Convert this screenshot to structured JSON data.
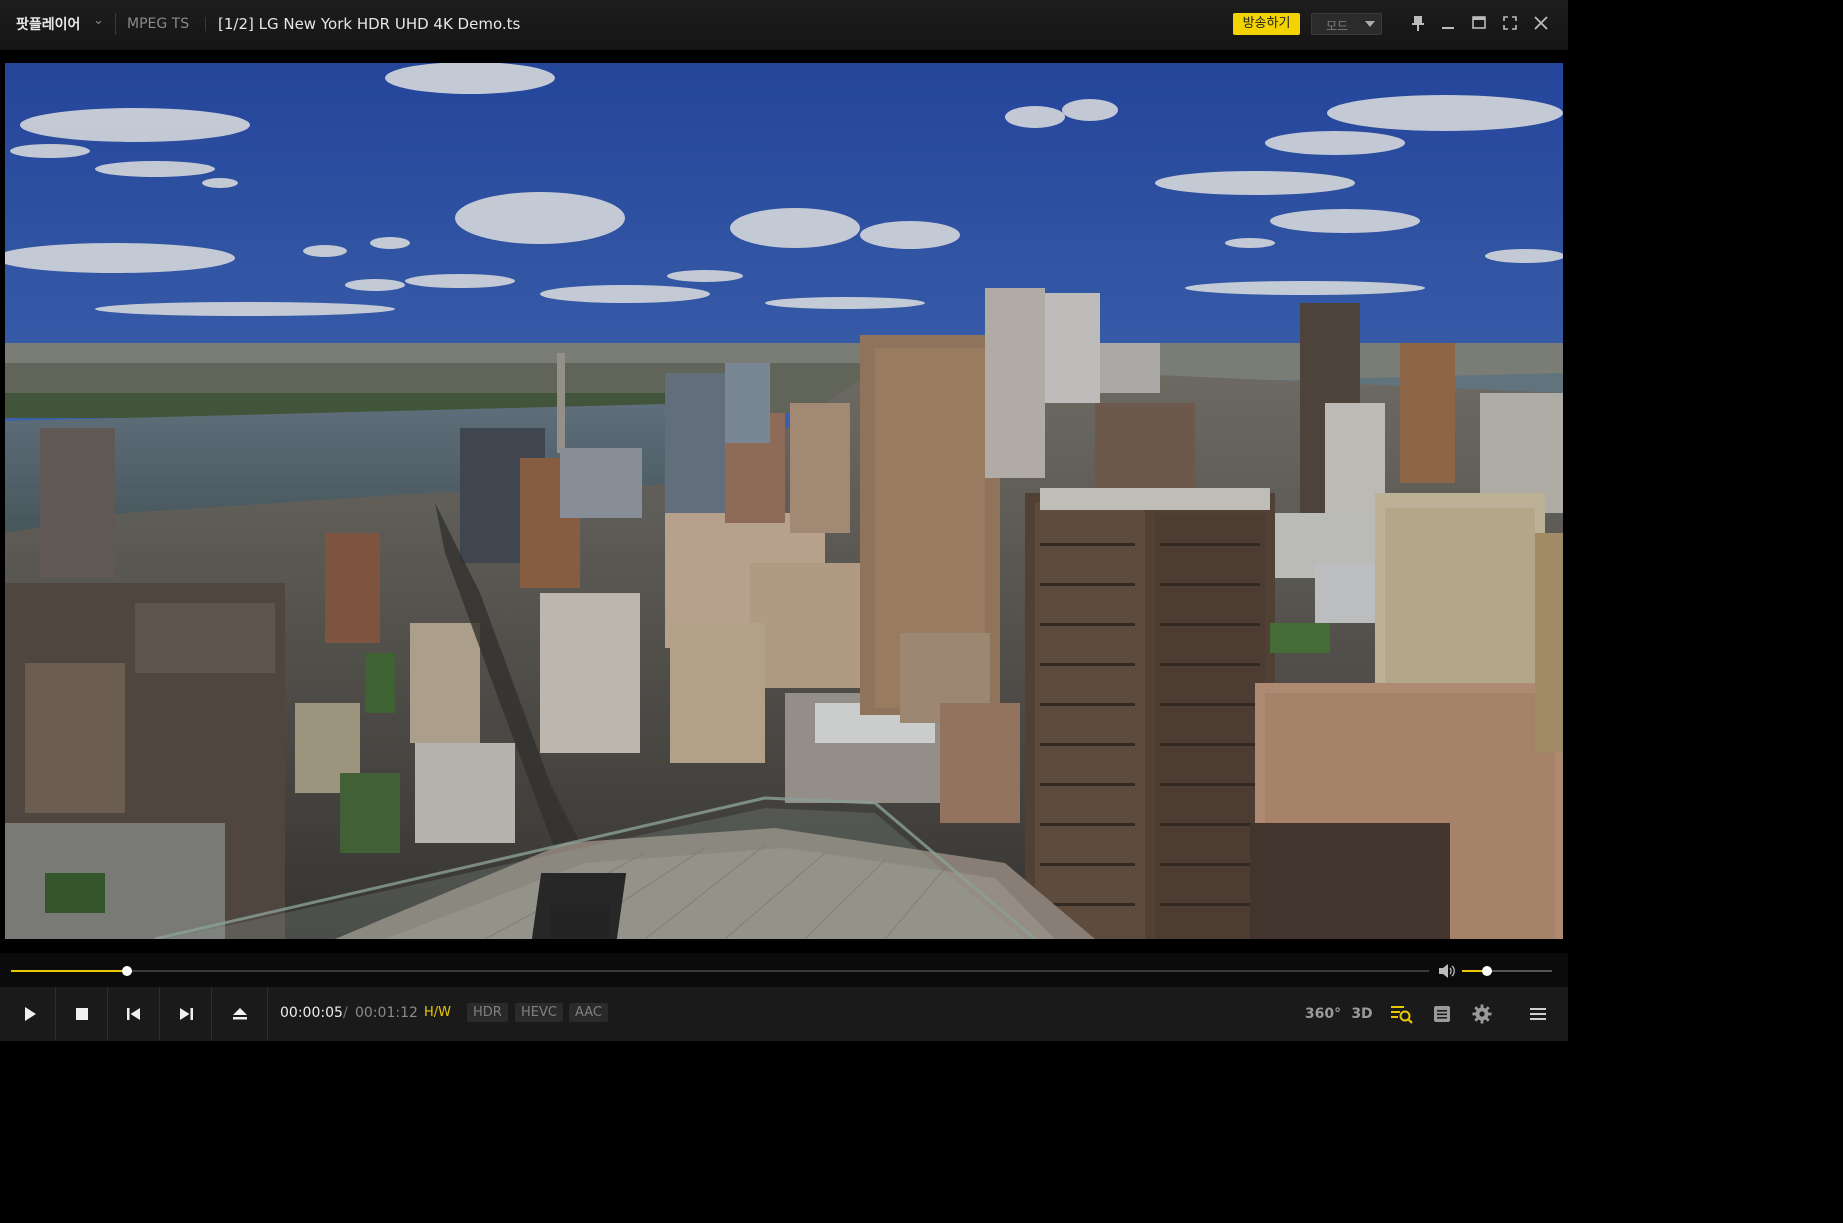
{
  "titlebar": {
    "app_name": "팟플레이어",
    "format": "MPEG TS",
    "file_title": "[1/2] LG New York HDR UHD 4K Demo.ts",
    "broadcast_label": "방송하기",
    "mode_label": "모드"
  },
  "video": {
    "description_icon": "video-frame"
  },
  "playback": {
    "progress_fraction": 0.082,
    "volume_fraction": 0.28,
    "current_time": "00:00:05",
    "time_separator": "/",
    "total_time": "00:01:12",
    "hw_label": "H/W",
    "badges": [
      "HDR",
      "HEVC",
      "AAC"
    ],
    "btn_360": "360°",
    "btn_3d": "3D"
  },
  "colors": {
    "accent": "#e8c800",
    "broadcast_bg": "#f3d400",
    "titlebar_bg": "#1d1d1d",
    "controls_bg": "#1a1a1a"
  }
}
